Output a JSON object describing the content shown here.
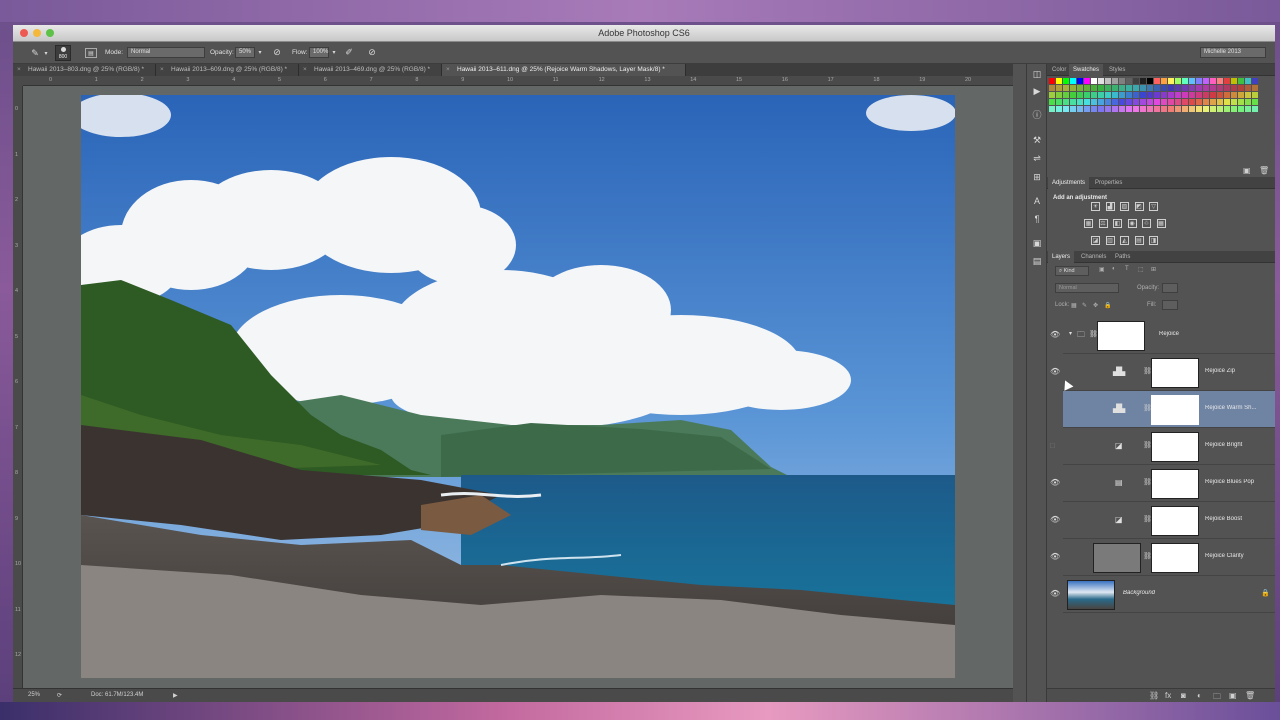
{
  "app": {
    "title": "Adobe Photoshop CS6",
    "workspace": "Michelle 2013"
  },
  "options_bar": {
    "brush_size": "800",
    "mode_label": "Mode:",
    "mode_value": "Normal",
    "opacity_label": "Opacity:",
    "opacity_value": "50%",
    "flow_label": "Flow:",
    "flow_value": "100%"
  },
  "doc_tabs": [
    {
      "label": "Hawaii 2013–803.dng @ 25% (RGB/8) *"
    },
    {
      "label": "Hawaii 2013–609.dng @ 25% (RGB/8) *"
    },
    {
      "label": "Hawaii 2013–469.dng @ 25% (RGB/8) *"
    },
    {
      "label": "Hawaii 2013–611.dng @ 25% (Rejoice Warm Shadows, Layer Mask/8) *"
    }
  ],
  "ruler_h": [
    "0",
    "1",
    "2",
    "3",
    "4",
    "5",
    "6",
    "7",
    "8",
    "9",
    "10",
    "11",
    "12",
    "13",
    "14",
    "15",
    "16",
    "17",
    "18",
    "19",
    "20"
  ],
  "ruler_v": [
    "0",
    "1",
    "2",
    "3",
    "4",
    "5",
    "6",
    "7",
    "8",
    "9",
    "10",
    "11",
    "12",
    "13"
  ],
  "status": {
    "zoom": "25%",
    "doc": "Doc: 61.7M/123.4M"
  },
  "color_panel": {
    "tabs": [
      "Color",
      "Swatches",
      "Styles"
    ]
  },
  "adjust_panel": {
    "tabs": [
      "Adjustments",
      "Properties"
    ],
    "heading": "Add an adjustment"
  },
  "layers_panel": {
    "tabs": [
      "Layers",
      "Channels",
      "Paths"
    ],
    "filter_label": "Kind",
    "blend_mode": "Normal",
    "opacity_label": "Opacity:",
    "lock_label": "Lock:",
    "fill_label": "Fill:",
    "layers": [
      {
        "name": "Rejoice"
      },
      {
        "name": "Rejoice Zip"
      },
      {
        "name": "Rejoice Warm Sh..."
      },
      {
        "name": "Rejoice Bright"
      },
      {
        "name": "Rejoice Blues Pop"
      },
      {
        "name": "Rejoice Boost"
      },
      {
        "name": "Rejoice Clarity"
      },
      {
        "name": "Background"
      }
    ]
  },
  "colors": {
    "selected_layer": "#6f83a3",
    "panel_bg": "#535353"
  }
}
